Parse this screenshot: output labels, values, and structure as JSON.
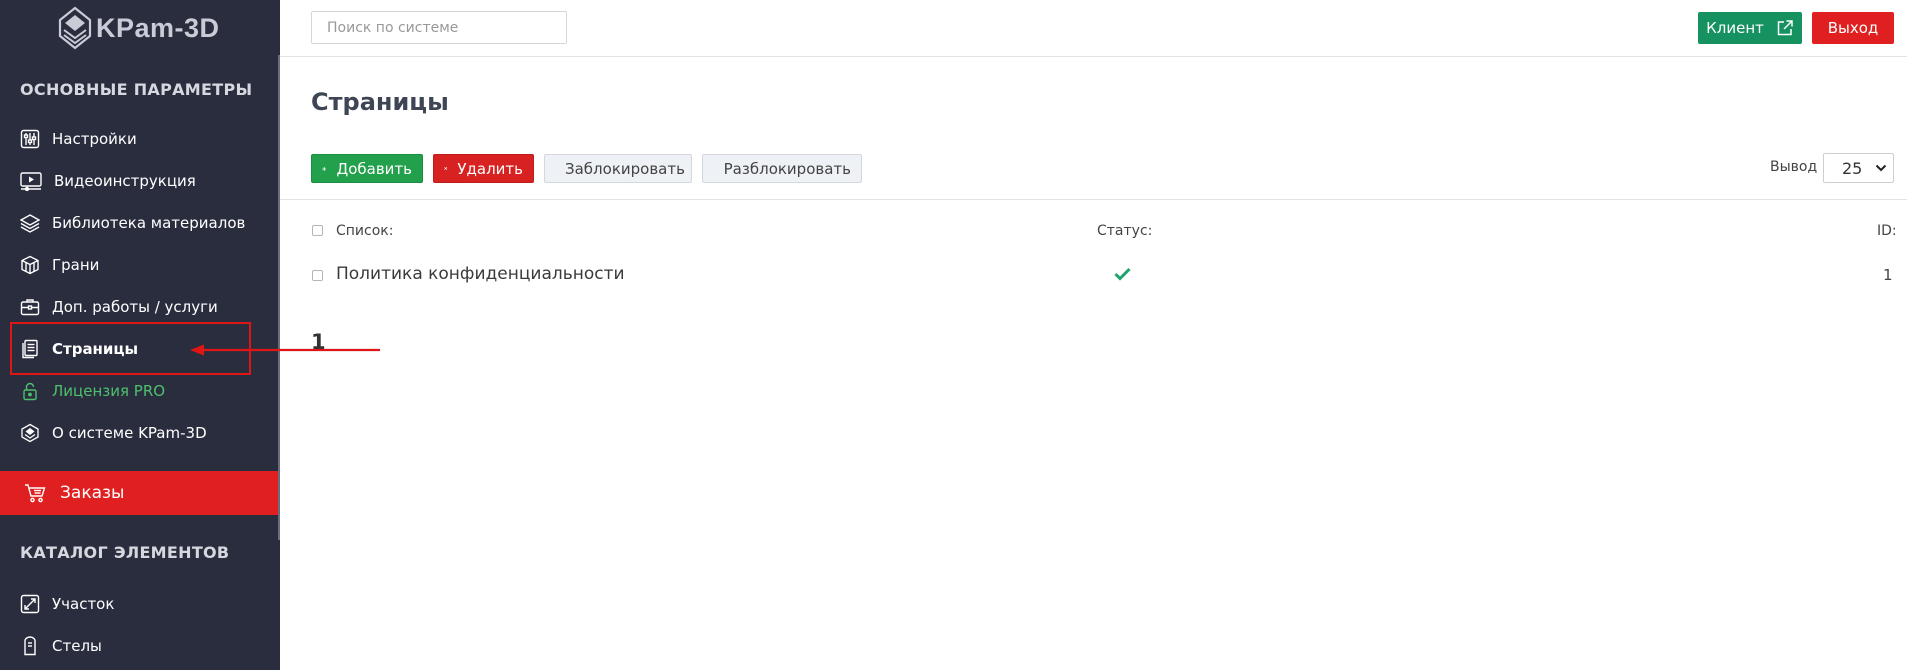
{
  "app": {
    "logo_text": "KPam-3D"
  },
  "sidebar": {
    "section_main": "ОСНОВНЫЕ ПАРАМЕТРЫ",
    "items": [
      {
        "label": "Настройки",
        "icon": "sliders-icon"
      },
      {
        "label": "Видеоинструкция",
        "icon": "video-icon"
      },
      {
        "label": "Библиотека материалов",
        "icon": "layers-icon"
      },
      {
        "label": "Грани",
        "icon": "cube-icon"
      },
      {
        "label": "Доп. работы / услуги",
        "icon": "briefcase-icon"
      },
      {
        "label": "Страницы",
        "icon": "pages-icon",
        "active": true
      },
      {
        "label": "Лицензия PRO",
        "icon": "lock-icon"
      },
      {
        "label": "О системе KPam-3D",
        "icon": "logo-small-icon"
      }
    ],
    "orders_label": "Заказы",
    "section_catalog": "КАТАЛОГ ЭЛЕМЕНТОВ",
    "catalog_items": [
      {
        "label": "Участок",
        "icon": "expand-icon"
      },
      {
        "label": "Стелы",
        "icon": "stele-icon"
      }
    ]
  },
  "topbar": {
    "search_placeholder": "Поиск по системе",
    "client_label": "Клиент",
    "exit_label": "Выход"
  },
  "main": {
    "title": "Страницы",
    "toolbar": {
      "add": "Добавить",
      "delete": "Удалить",
      "block": "Заблокировать",
      "unblock": "Разблокировать"
    },
    "output_label": "Вывод",
    "output_value": "25",
    "columns": {
      "list": "Список:",
      "status": "Статус:",
      "id": "ID:"
    },
    "rows": [
      {
        "title": "Политика конфиденциальности",
        "status": "active",
        "id": "1"
      }
    ],
    "pagination": [
      "1"
    ]
  },
  "colors": {
    "sidebar_bg": "#2a2d3e",
    "accent_red": "#e02020",
    "accent_green": "#15925f",
    "status_green": "#1fa36a",
    "pro_green": "#4cc06c"
  }
}
